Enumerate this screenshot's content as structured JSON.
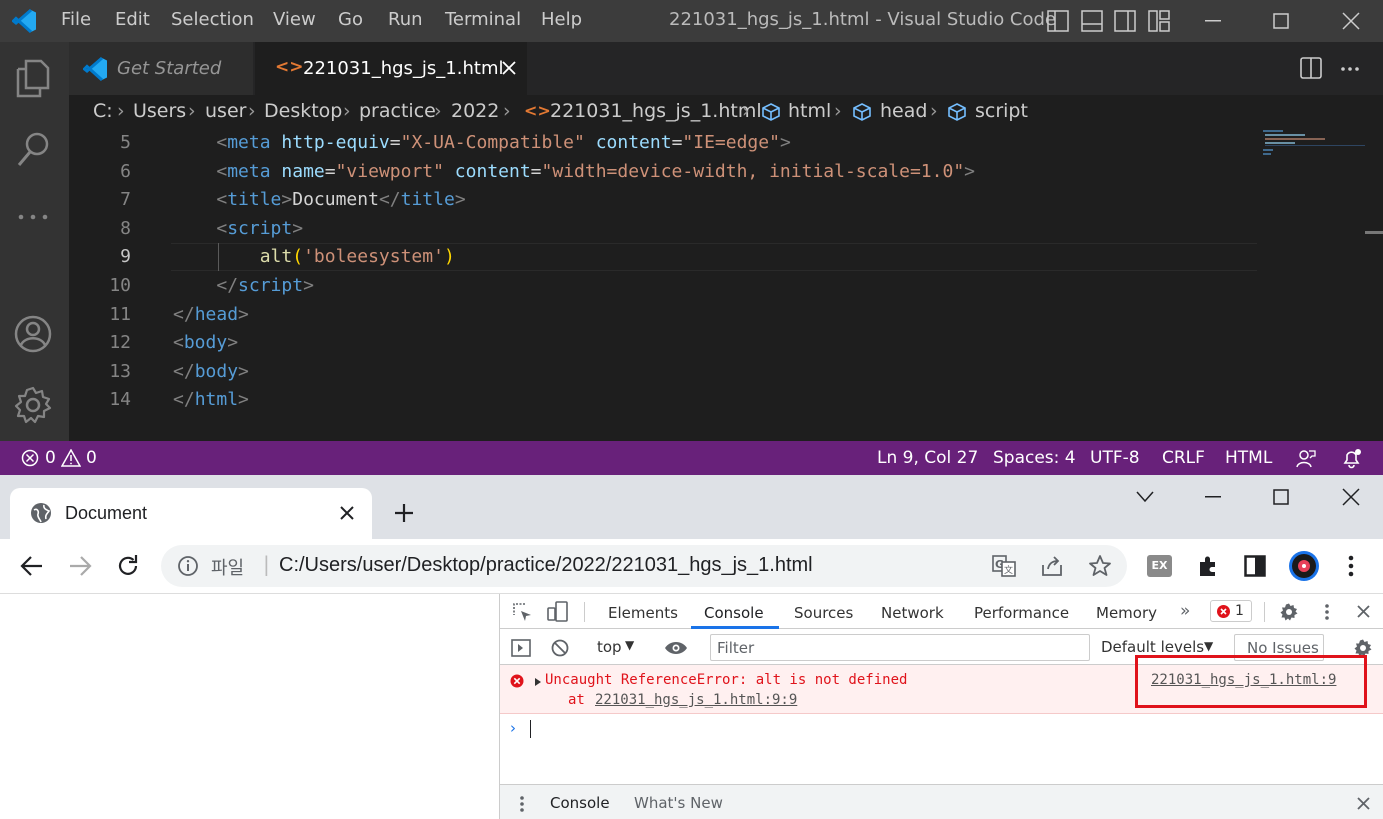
{
  "vscode": {
    "menu": [
      "File",
      "Edit",
      "Selection",
      "View",
      "Go",
      "Run",
      "Terminal",
      "Help"
    ],
    "window_title": "221031_hgs_js_1.html - Visual Studio Code",
    "tabs": [
      {
        "label": "Get Started"
      },
      {
        "label": "221031_hgs_js_1.html"
      }
    ],
    "breadcrumb": [
      "C:",
      "Users",
      "user",
      "Desktop",
      "practice",
      "2022",
      "221031_hgs_js_1.html",
      "html",
      "head",
      "script"
    ],
    "lines": [
      {
        "num": "5",
        "indent": "    ",
        "tokens": [
          {
            "t": "<",
            "c": "#808080"
          },
          {
            "t": "meta",
            "c": "#569cd6"
          },
          {
            "t": " http-equiv",
            "c": "#9cdcfe"
          },
          {
            "t": "=",
            "c": "#d4d4d4"
          },
          {
            "t": "\"X-UA-Compatible\"",
            "c": "#ce9178"
          },
          {
            "t": " content",
            "c": "#9cdcfe"
          },
          {
            "t": "=",
            "c": "#d4d4d4"
          },
          {
            "t": "\"IE=edge\"",
            "c": "#ce9178"
          },
          {
            "t": ">",
            "c": "#808080"
          }
        ]
      },
      {
        "num": "6",
        "indent": "    ",
        "tokens": [
          {
            "t": "<",
            "c": "#808080"
          },
          {
            "t": "meta",
            "c": "#569cd6"
          },
          {
            "t": " name",
            "c": "#9cdcfe"
          },
          {
            "t": "=",
            "c": "#d4d4d4"
          },
          {
            "t": "\"viewport\"",
            "c": "#ce9178"
          },
          {
            "t": " content",
            "c": "#9cdcfe"
          },
          {
            "t": "=",
            "c": "#d4d4d4"
          },
          {
            "t": "\"width=device-width, initial-scale=1.0\"",
            "c": "#ce9178"
          },
          {
            "t": ">",
            "c": "#808080"
          }
        ]
      },
      {
        "num": "7",
        "indent": "    ",
        "tokens": [
          {
            "t": "<",
            "c": "#808080"
          },
          {
            "t": "title",
            "c": "#569cd6"
          },
          {
            "t": ">",
            "c": "#808080"
          },
          {
            "t": "Document",
            "c": "#d4d4d4"
          },
          {
            "t": "</",
            "c": "#808080"
          },
          {
            "t": "title",
            "c": "#569cd6"
          },
          {
            "t": ">",
            "c": "#808080"
          }
        ]
      },
      {
        "num": "8",
        "indent": "    ",
        "tokens": [
          {
            "t": "<",
            "c": "#808080"
          },
          {
            "t": "script",
            "c": "#569cd6"
          },
          {
            "t": ">",
            "c": "#808080"
          }
        ]
      },
      {
        "num": "9",
        "indent": "        ",
        "tokens": [
          {
            "t": "alt",
            "c": "#dcdcaa"
          },
          {
            "t": "(",
            "c": "#ffd700"
          },
          {
            "t": "'boleesystem'",
            "c": "#ce9178"
          },
          {
            "t": ")",
            "c": "#ffd700"
          }
        ]
      },
      {
        "num": "10",
        "indent": "    ",
        "tokens": [
          {
            "t": "</",
            "c": "#808080"
          },
          {
            "t": "script",
            "c": "#569cd6"
          },
          {
            "t": ">",
            "c": "#808080"
          }
        ]
      },
      {
        "num": "11",
        "indent": "",
        "tokens": [
          {
            "t": "</",
            "c": "#808080"
          },
          {
            "t": "head",
            "c": "#569cd6"
          },
          {
            "t": ">",
            "c": "#808080"
          }
        ]
      },
      {
        "num": "12",
        "indent": "",
        "tokens": [
          {
            "t": "<",
            "c": "#808080"
          },
          {
            "t": "body",
            "c": "#569cd6"
          },
          {
            "t": ">",
            "c": "#808080"
          }
        ]
      },
      {
        "num": "13",
        "indent": "",
        "tokens": [
          {
            "t": "</",
            "c": "#808080"
          },
          {
            "t": "body",
            "c": "#569cd6"
          },
          {
            "t": ">",
            "c": "#808080"
          }
        ]
      },
      {
        "num": "14",
        "indent": "",
        "tokens": [
          {
            "t": "</",
            "c": "#808080"
          },
          {
            "t": "html",
            "c": "#569cd6"
          },
          {
            "t": ">",
            "c": "#808080"
          }
        ]
      }
    ],
    "current_line": "9",
    "status": {
      "errors": "0",
      "warnings": "0",
      "position": "Ln 9, Col 27",
      "spaces": "Spaces: 4",
      "encoding": "UTF-8",
      "eol": "CRLF",
      "language": "HTML"
    },
    "status_color": "#68217a"
  },
  "chrome": {
    "tab_title": "Document",
    "address_label": "파일",
    "address": "C:/Users/user/Desktop/practice/2022/221031_hgs_js_1.html",
    "ext_badge": "EX"
  },
  "devtools": {
    "tabs": [
      "Elements",
      "Console",
      "Sources",
      "Network",
      "Performance",
      "Memory"
    ],
    "active_tab": "Console",
    "error_count": "1",
    "context": "top",
    "filter_placeholder": "Filter",
    "levels": "Default levels",
    "issues": "No Issues",
    "error_message": "Uncaught ReferenceError: alt is not defined",
    "error_at": "at ",
    "error_at_link": "221031_hgs_js_1.html:9:9",
    "error_source": "221031_hgs_js_1.html:9",
    "drawer_tabs": [
      "Console",
      "What's New"
    ],
    "highlight_color": "#e0131b"
  }
}
